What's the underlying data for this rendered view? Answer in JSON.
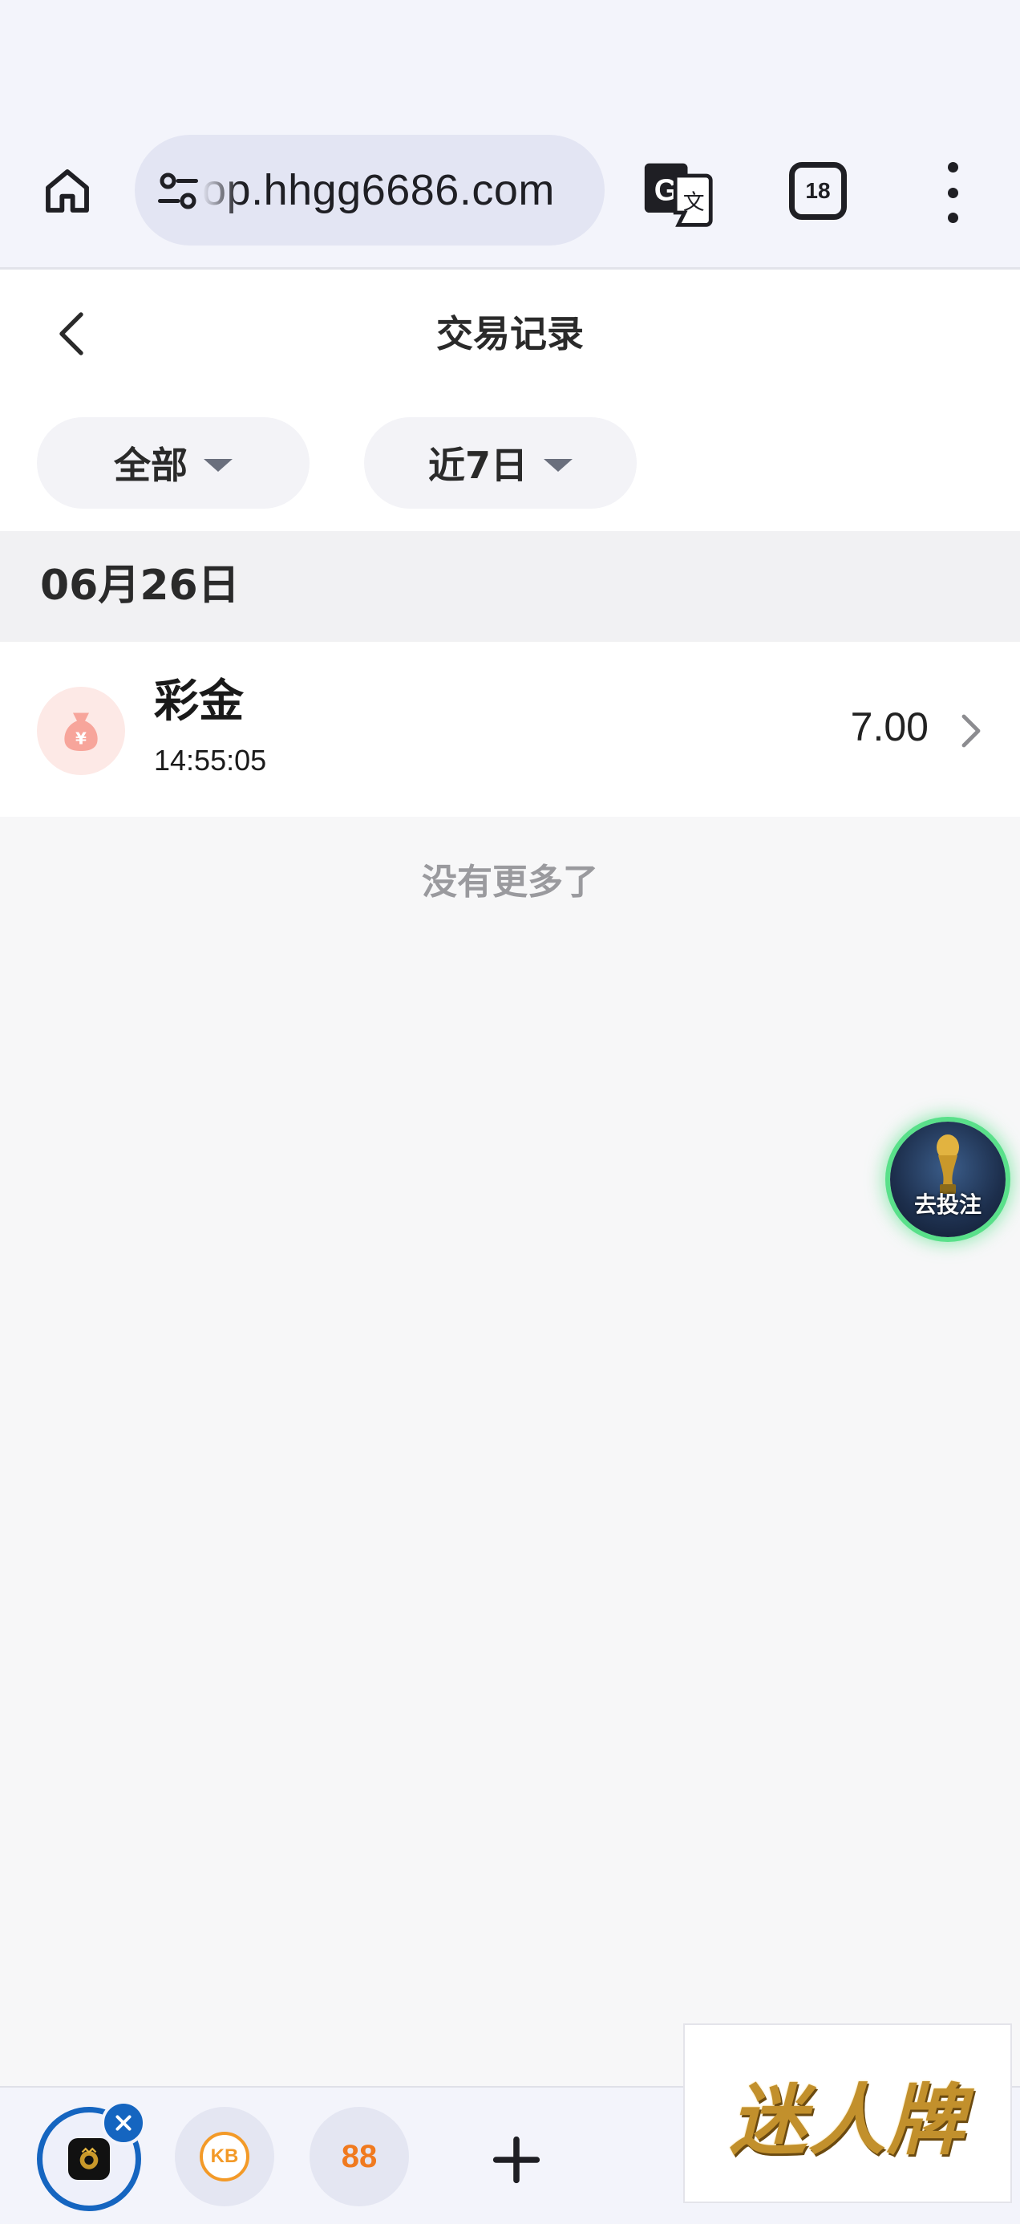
{
  "browser": {
    "url": "op.hhgg6686.com",
    "tab_count": "18"
  },
  "page": {
    "title": "交易记录",
    "filters": {
      "type_label": "全部",
      "range_label": "近7日"
    }
  },
  "records": {
    "date": "06月26日",
    "items": [
      {
        "title": "彩金",
        "time": "14:55:05",
        "amount": "7.00"
      }
    ],
    "end_text": "没有更多了"
  },
  "floating_promo": {
    "label": "去投注"
  },
  "tab_strip": {
    "tabs": [
      "kb-icon",
      "88"
    ],
    "kb_label": "KB",
    "n88_label": "88"
  },
  "watermark": {
    "text": "迷人牌"
  },
  "colors": {
    "accent": "#1565c0",
    "promo_glow": "#59e08a",
    "money_icon": "#f7a59b"
  }
}
